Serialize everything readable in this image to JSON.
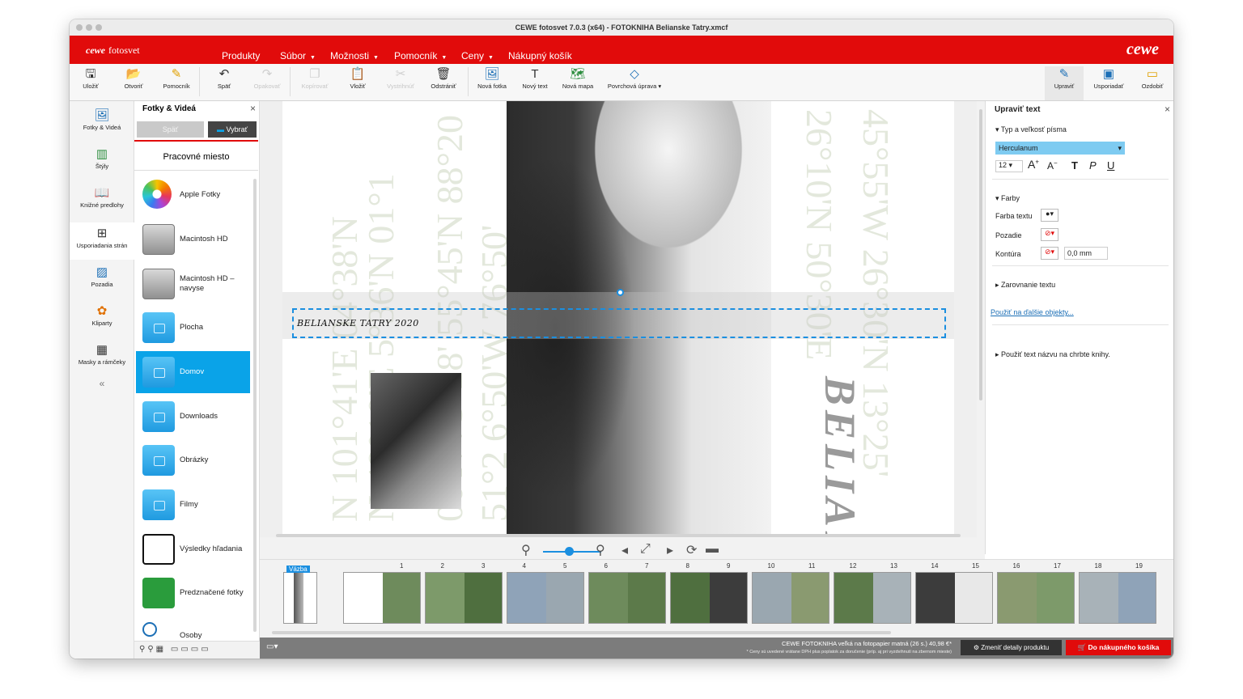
{
  "window": {
    "title": "CEWE fotosvet 7.0.3 (x64) -  FOTOKNIHA Belianske Tatry.xmcf"
  },
  "brand": {
    "left_logo": "cewe",
    "left_name": "fotosvet",
    "right_logo": "cewe"
  },
  "menu": [
    {
      "label": "Produkty"
    },
    {
      "label": "Súbor"
    },
    {
      "label": "Možnosti"
    },
    {
      "label": "Pomocník"
    },
    {
      "label": "Ceny"
    },
    {
      "label": "Nákupný košík"
    }
  ],
  "toolbar": {
    "items": [
      "Uložiť",
      "Otvoriť",
      "Pomocník",
      "Späť",
      "Opakovať",
      "Kopírovať",
      "Vložiť",
      "Vystrihnúť",
      "Odstrániť",
      "Nová fotka",
      "Nový text",
      "Nová mapa",
      "Povrchová úprava"
    ],
    "right": [
      "Upraviť",
      "Usporiadať",
      "Ozdobiť"
    ]
  },
  "leftnav": [
    "Fotky & Videá",
    "Štýly",
    "Knižné predlohy",
    "Usporiadania strán",
    "Pozadia",
    "Kliparty",
    "Masky a rámčeky"
  ],
  "leftnav_collapse": "«",
  "panel": {
    "title": "Fotky & Videá",
    "close": "×",
    "back": "Späť",
    "select": "Vybrať",
    "workplace": "Pracovné miesto",
    "sources": [
      {
        "label": "Apple Fotky",
        "icon": "apple-photos-icon"
      },
      {
        "label": "Macintosh HD",
        "icon": "harddisk-icon"
      },
      {
        "label": "Macintosh HD – navyse",
        "icon": "harddisk-icon"
      },
      {
        "label": "Plocha",
        "icon": "folder-icon"
      },
      {
        "label": "Domov",
        "icon": "home-folder-icon"
      },
      {
        "label": "Downloads",
        "icon": "download-folder-icon"
      },
      {
        "label": "Obrázky",
        "icon": "picture-folder-icon"
      },
      {
        "label": "Filmy",
        "icon": "movie-folder-icon"
      },
      {
        "label": "Výsledky hľadania",
        "icon": "search-results-icon"
      },
      {
        "label": "Predznačené fotky",
        "icon": "marked-photos-icon"
      },
      {
        "label": "Osoby",
        "icon": "people-icon"
      }
    ]
  },
  "page": {
    "text": "BELIANSKE TATRY 2020",
    "spine": "BELIAI"
  },
  "rightpanel": {
    "title": "Upraviť text",
    "close": "×",
    "font_section": "Typ a veľkosť písma",
    "font": "Herculanum",
    "size": "12",
    "colors_section": "Farby",
    "text_color": "Farba textu",
    "background": "Pozadie",
    "outline": "Kontúra",
    "outline_value": "0,0 mm",
    "align": "Zarovnanie textu",
    "apply_link": "Použiť na ďalšie objekty...",
    "spine_text": "Použiť text názvu na chrbte knihy."
  },
  "filmstrip": {
    "cover": "Väzba",
    "pages": [
      "1",
      "2",
      "3",
      "4",
      "5",
      "6",
      "7",
      "8",
      "9",
      "10",
      "11",
      "12",
      "13",
      "14",
      "15",
      "16",
      "17",
      "18",
      "19"
    ]
  },
  "status": {
    "price": "CEWE FOTOKNIHA veľká na fotopapier matná (26 s.) 40,98 €*",
    "note": "* Ceny sú uvedené vrátane DPH plus poplatok za doručenie (príp. aj pri vyzdvihnutí na zbernom mieste)",
    "change": "Zmeniť detaily produktu",
    "cart": "Do nákupného košíka"
  }
}
